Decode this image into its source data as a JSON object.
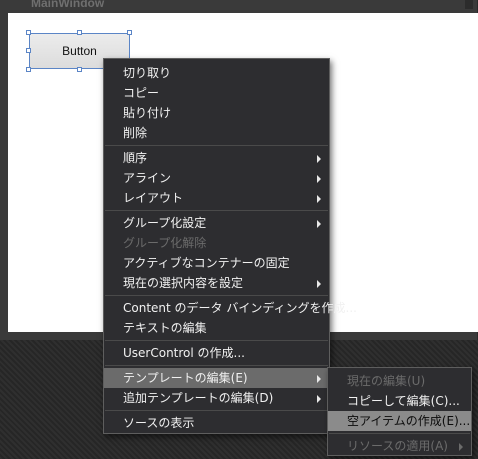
{
  "window": {
    "title": "MainWindow"
  },
  "design_surface": {
    "button_label": "Button"
  },
  "context_menu": {
    "groups": [
      [
        {
          "label": "切り取り",
          "submenu": false,
          "enabled": true
        },
        {
          "label": "コピー",
          "submenu": false,
          "enabled": true
        },
        {
          "label": "貼り付け",
          "submenu": false,
          "enabled": true
        },
        {
          "label": "削除",
          "submenu": false,
          "enabled": true
        }
      ],
      [
        {
          "label": "順序",
          "submenu": true,
          "enabled": true
        },
        {
          "label": "アライン",
          "submenu": true,
          "enabled": true
        },
        {
          "label": "レイアウト",
          "submenu": true,
          "enabled": true
        }
      ],
      [
        {
          "label": "グループ化設定",
          "submenu": true,
          "enabled": true
        },
        {
          "label": "グループ化解除",
          "submenu": false,
          "enabled": false
        },
        {
          "label": "アクティブなコンテナーの固定",
          "submenu": false,
          "enabled": true
        },
        {
          "label": "現在の選択内容を設定",
          "submenu": true,
          "enabled": true
        }
      ],
      [
        {
          "label": "Content のデータ バインディングを作成...",
          "submenu": false,
          "enabled": true
        },
        {
          "label": "テキストの編集",
          "submenu": false,
          "enabled": true
        }
      ],
      [
        {
          "label": "UserControl の作成...",
          "submenu": false,
          "enabled": true
        }
      ],
      [
        {
          "label": "テンプレートの編集(E)",
          "submenu": true,
          "enabled": true,
          "highlighted": true
        },
        {
          "label": "追加テンプレートの編集(D)",
          "submenu": true,
          "enabled": true
        }
      ],
      [
        {
          "label": "ソースの表示",
          "submenu": false,
          "enabled": true
        }
      ]
    ]
  },
  "submenu": {
    "items": [
      {
        "label": "現在の編集(U)",
        "enabled": false,
        "submenu": false
      },
      {
        "label": "コピーして編集(C)...",
        "enabled": true,
        "submenu": false
      },
      {
        "label": "空アイテムの作成(E)...",
        "enabled": true,
        "submenu": false,
        "highlighted": true
      },
      {
        "label": "リソースの適用(A)",
        "enabled": false,
        "submenu": true
      }
    ]
  }
}
